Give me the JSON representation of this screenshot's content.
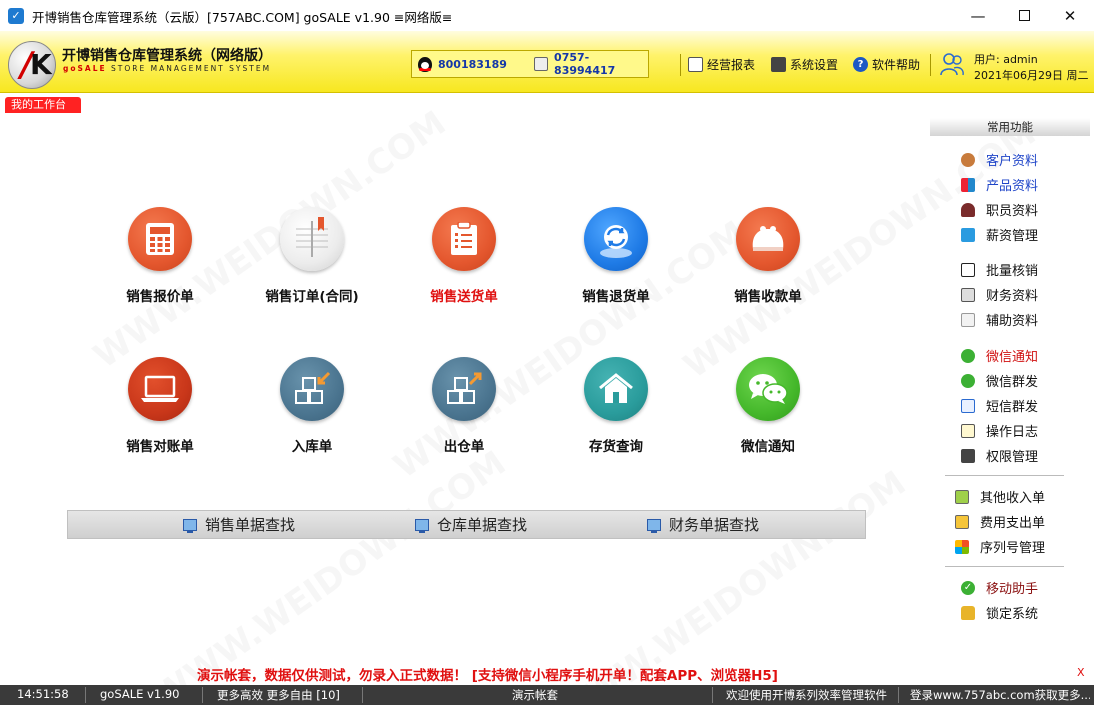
{
  "window": {
    "title": "开博销售仓库管理系统（云版）[757ABC.COM]  goSALE v1.90   ≡网络版≡",
    "minimize": "—",
    "close": "✕"
  },
  "header": {
    "brand_title": "开博销售仓库管理系统（网络版）",
    "brand_sub_prefix": "goSALE",
    "brand_sub_rest": " STORE MANAGEMENT SYSTEM",
    "qq": "800183189",
    "tel": "0757-83994417",
    "buttons": {
      "report": "经营报表",
      "settings": "系统设置",
      "help": "软件帮助"
    },
    "user": "用户: admin",
    "date": "2021年06月29日 周二"
  },
  "workspace_tab": "我的工作台",
  "modules": [
    {
      "label": "销售报价单",
      "icon": "calculator-icon"
    },
    {
      "label": "销售订单(合同)",
      "icon": "notebook-icon"
    },
    {
      "label": "销售送货单",
      "icon": "clipboard-icon"
    },
    {
      "label": "销售退货单",
      "icon": "refresh-icon"
    },
    {
      "label": "销售收款单",
      "icon": "purse-icon"
    },
    {
      "label": "销售对账单",
      "icon": "laptop-icon"
    },
    {
      "label": "入库单",
      "icon": "stock-in-icon"
    },
    {
      "label": "出仓单",
      "icon": "stock-out-icon"
    },
    {
      "label": "存货查询",
      "icon": "house-icon"
    },
    {
      "label": "微信通知",
      "icon": "wechat-icon"
    }
  ],
  "search": {
    "sales": "销售单据查找",
    "warehouse": "仓库单据查找",
    "finance": "财务单据查找"
  },
  "right_panel": {
    "header": "常用功能",
    "items": [
      "客户资料",
      "产品资料",
      "职员资料",
      "薪资管理",
      "批量核销",
      "财务资料",
      "辅助资料",
      "微信通知",
      "微信群发",
      "短信群发",
      "操作日志",
      "权限管理",
      "其他收入单",
      "费用支出单",
      "序列号管理",
      "移动助手",
      "锁定系统"
    ]
  },
  "notice": "演示帐套，数据仅供测试，勿录入正式数据！ [支持微信小程序手机开单！配套APP、浏览器H5]",
  "notice_close": "X",
  "statusbar": {
    "time": "14:51:58",
    "version": "goSALE v1.90",
    "slogan": "更多高效 更多自由 [10]",
    "account": "演示帐套",
    "welcome": "欢迎使用开博系列效率管理软件",
    "site": "登录www.757abc.com获取更多..."
  },
  "watermark": "WWW.WEIDOWN.COM",
  "colors": {
    "header_yellow": "#fff36a",
    "accent_red": "#e01010",
    "link_blue": "#1f45c8"
  }
}
